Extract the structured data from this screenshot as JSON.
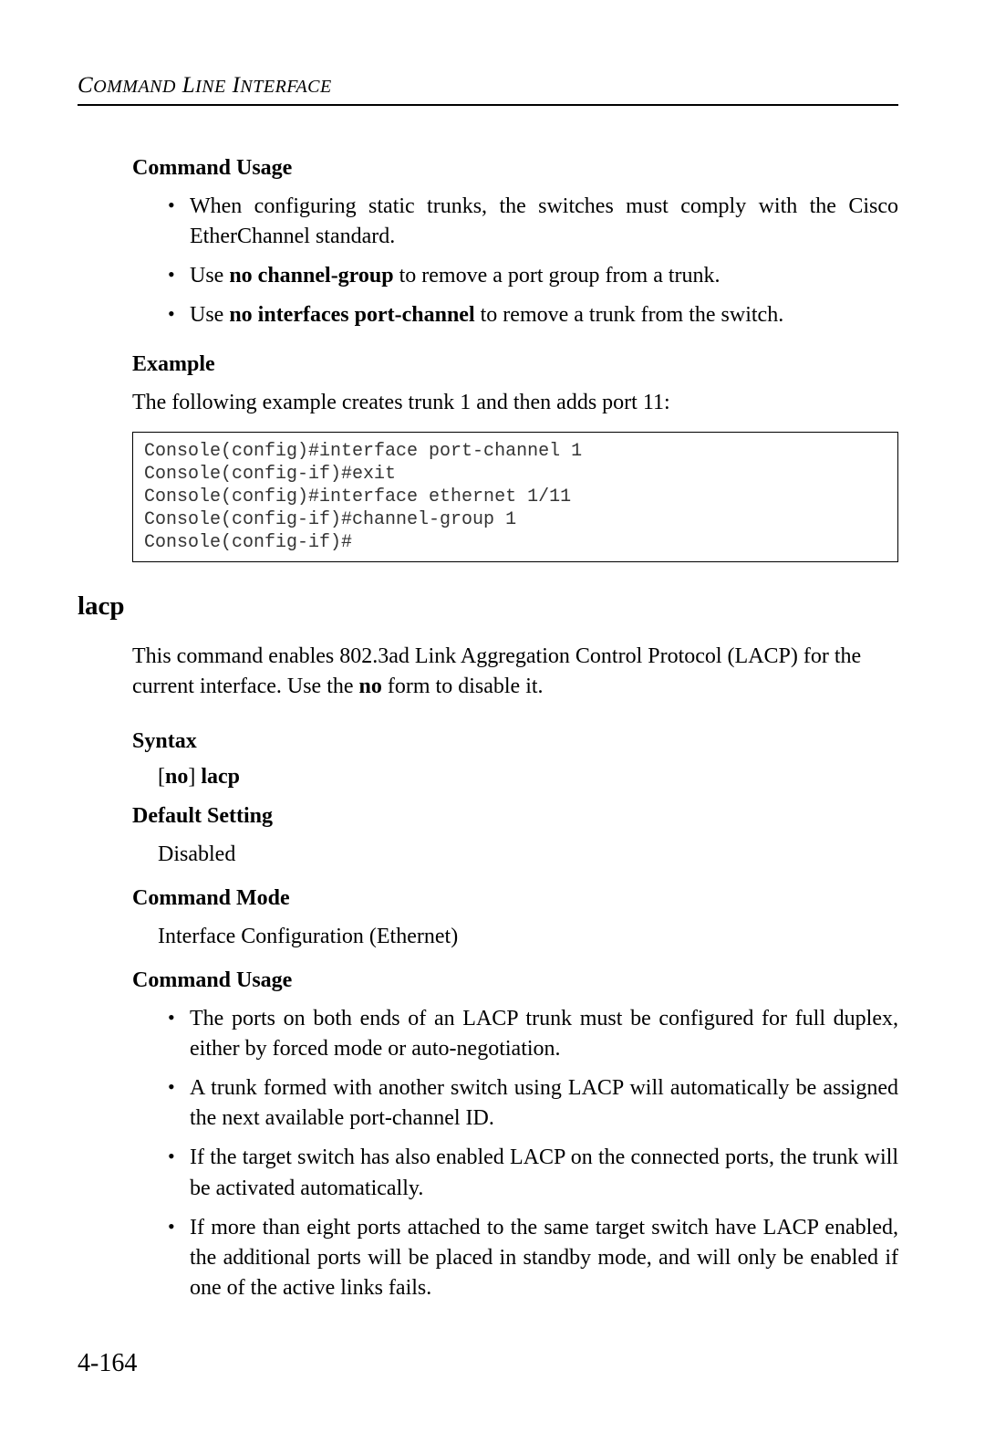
{
  "header": {
    "title": "Command Line Interface"
  },
  "sections": {
    "command_usage_1": {
      "heading": "Command Usage",
      "bullets": {
        "b1": "When configuring static trunks, the switches must comply with the Cisco EtherChannel standard.",
        "b2_prefix": "Use ",
        "b2_bold": "no channel-group",
        "b2_suffix": " to remove a port group from a trunk.",
        "b3_prefix": "Use ",
        "b3_bold": "no interfaces port-channel",
        "b3_suffix": " to remove a trunk from the switch."
      }
    },
    "example": {
      "heading": "Example",
      "intro": "The following example creates trunk 1 and then adds port 11:",
      "code": "Console(config)#interface port-channel 1\nConsole(config-if)#exit\nConsole(config)#interface ethernet 1/11\nConsole(config-if)#channel-group 1\nConsole(config-if)#"
    },
    "lacp": {
      "heading": "lacp",
      "desc_prefix": "This command enables 802.3ad Link Aggregation Control Protocol (LACP) for the current interface. Use the ",
      "desc_bold": "no",
      "desc_suffix": " form to disable it."
    },
    "syntax": {
      "heading": "Syntax",
      "line_prefix": "[",
      "line_bold1": "no",
      "line_mid": "] ",
      "line_bold2": "lacp"
    },
    "default_setting": {
      "heading": "Default Setting",
      "value": "Disabled"
    },
    "command_mode": {
      "heading": "Command Mode",
      "value": "Interface Configuration (Ethernet)"
    },
    "command_usage_2": {
      "heading": "Command Usage",
      "bullets": {
        "b1": "The ports on both ends of an LACP trunk must be configured for full duplex, either by forced mode or auto-negotiation.",
        "b2": "A trunk formed with another switch using LACP will automatically be assigned the next available port-channel ID.",
        "b3": "If the target switch has also enabled LACP on the connected ports, the trunk will be activated automatically.",
        "b4": "If more than eight ports attached to the same target switch have LACP enabled, the additional ports will be placed in standby mode, and will only be enabled if one of the active links fails."
      }
    }
  },
  "page_number": "4-164"
}
